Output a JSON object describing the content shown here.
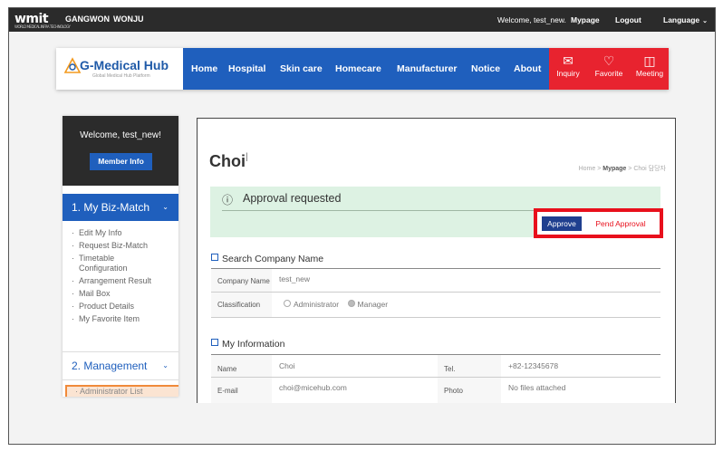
{
  "topbar": {
    "logo": "wmit",
    "logo_sub": "WORLD MEDICAL INFRA TECHNOLOGY",
    "region1": "GANGWON",
    "region2": "WONJU",
    "welcome": "Welcome, test_new.",
    "mypage": "Mypage",
    "logout": "Logout",
    "language": "Language"
  },
  "brand": {
    "title": "G-Medical Hub",
    "subtitle": "Global Medical Hub Platform",
    "color": "#1f5aa8"
  },
  "nav": {
    "items": [
      "Home",
      "Hospital",
      "Skin care",
      "Homecare",
      "Manufacturer",
      "Notice",
      "About"
    ],
    "quick": [
      {
        "label": "Inquiry",
        "icon": "mail-icon"
      },
      {
        "label": "Favorite",
        "icon": "heart-icon"
      },
      {
        "label": "Meeting",
        "icon": "meeting-icon"
      }
    ],
    "blue": "#1f5fbd",
    "red": "#e8232f"
  },
  "sidebar": {
    "welcome": "Welcome, test_new!",
    "member_btn": "Member Info",
    "section1": "1. My Biz-Match",
    "section1_items": [
      "Edit My Info",
      "Request Biz-Match",
      "Timetable Configuration",
      "Arrangement Result",
      "Mail Box",
      "Product Details",
      "My Favorite Item"
    ],
    "section2": "2. Management",
    "section2_items": [
      "Administrator List"
    ]
  },
  "main": {
    "title": "Choi",
    "breadcrumb": {
      "home": "Home",
      "sep": ">",
      "mypage": "Mypage",
      "current": "Choi 담당자"
    },
    "alert": "Approval requested",
    "approve": "Approve",
    "pend": "Pend Approval",
    "company_section": "Search Company Name",
    "company_name_label": "Company Name",
    "company_name_value": "test_new",
    "classification_label": "Classification",
    "class_admin": "Administrator",
    "class_manager": "Manager",
    "info_section": "My Information",
    "name_label": "Name",
    "name_value": "Choi",
    "tel_label": "Tel.",
    "tel_value": "+82-12345678",
    "email_label": "E-mail",
    "email_value": "choi@micehub.com",
    "photo_label": "Photo",
    "photo_value": "No files attached"
  }
}
